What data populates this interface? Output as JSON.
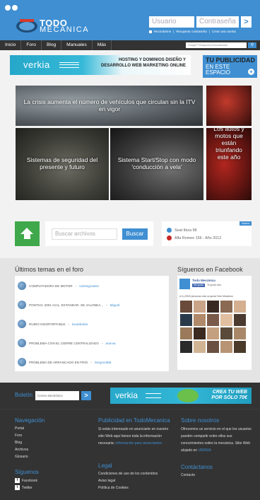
{
  "header": {
    "logo_todo": "TODO",
    "logo_mecanica": "MECANICA",
    "username_placeholder": "Usuario",
    "password_placeholder": "Contraseña",
    "login_go": ">",
    "remember": "Recordarme",
    "recover": "Recuperar contraseña",
    "create": "Crear una cuenta"
  },
  "nav": {
    "items": [
      "Inicio",
      "Foro",
      "Blog",
      "Manuales",
      "Más"
    ],
    "search_placeholder": "Google™ Búsqueda personalizada",
    "search_icon": "search-icon"
  },
  "ads": {
    "verkia_logo": "verkia",
    "verkia_text": "HOSTING Y DOMINIOS DISEÑO Y DESARROLLO WEB MARKETING ONLINE",
    "pub_line1": "TU PUBLICIDAD",
    "pub_line2": "EN ESTE ESPACIO",
    "pub_plus": "+"
  },
  "featured": [
    "La crisis aumenta el número de vehículos que circulan sin la ITV en vigor",
    "",
    "Sistemas de seguridad del presente y futuro",
    "Sistema Start/Stop con modo 'conducción a vela'",
    "Los autos y motos que están triunfando este año"
  ],
  "widgets": {
    "search_placeholder": "Buscar archivos",
    "search_button": "Buscar",
    "cars_tag": "Nuevo",
    "car1": "Seat Ibiza 98",
    "car2": "Alfa Romeo 156 - Año 2012"
  },
  "forum": {
    "title": "Últimos temas en el foro",
    "items": [
      {
        "topic": "COMPUTADORA DE MOTOR",
        "by": "carlosgozalez"
      },
      {
        "topic": "PONTIAC 2001 ACIL. ESTANDAR. SE JALONEA...",
        "by": "Migu3l"
      },
      {
        "topic": "RUIDO INSOPORTABLE",
        "by": "lucasbalvis"
      },
      {
        "topic": "PROBLEMA CON EL CIERRE CENTRALIZADO",
        "by": "aranva"
      },
      {
        "topic": "PROBLEMA DE ARRANCADO EN FRIO",
        "by": "Sergio1988"
      }
    ]
  },
  "facebook": {
    "title": "Síguenos en Facebook",
    "page_name": "Todo Mecánica",
    "like": "Me gusta",
    "like_text": "Te gusta esto",
    "people": "A ti y 5945 personas más os gusta Todo Mecánica",
    "face_colors": [
      "#6a4a3a",
      "#c9a488",
      "#3a2a24",
      "#8a6a52",
      "#d4b090",
      "#2a3a4a",
      "#b08a6a",
      "#7a5a4a",
      "#e0c0a0",
      "#4a3a30",
      "#9a7a5a",
      "#3a2a20",
      "#c4a080",
      "#5a4a3a",
      "#a88868",
      "#2a2a2a",
      "#d0b494",
      "#6a5040",
      "#b89474",
      "#4a3a2a"
    ]
  },
  "footer": {
    "newsletter_label": "Boletín",
    "newsletter_placeholder": "Correo electrónico",
    "newsletter_btn": ">",
    "ad_web_logo": "verkia",
    "ad_web_text": "CREA TU WEB POR SÓLO 70€",
    "nav_title": "Navegación",
    "nav_links": [
      "Portal",
      "Foro",
      "Blog",
      "Archivos",
      "Glosario"
    ],
    "pub_title": "Publicidad en TodoMecanica",
    "pub_text": "Si estás interesado en anunciarte en nuestro sitio Web aquí tienes toda la información necesaria:",
    "pub_link": "información para anunciantes",
    "about_title": "Sobre nosotros",
    "about_text": "Ofrecemos un servicio en el que los usuarios pueden compartir entre ellos sus conocimientos sobre la mecánica. Sitio Web alojado en",
    "about_link": "VERKIA",
    "follow_title": "Síguenos",
    "facebook": "Facebook",
    "twitter": "Twitter",
    "legal_title": "Legal",
    "legal_links": [
      "Condiciones de uso de los contenidos",
      "Aviso legal",
      "Política de Cookies"
    ],
    "contact_title": "Contáctanos",
    "contact_link": "Contacto"
  },
  "colors": {
    "brand_blue": "#3f8fd2",
    "upload_green": "#3fa84a",
    "footer_bg": "#333333"
  }
}
